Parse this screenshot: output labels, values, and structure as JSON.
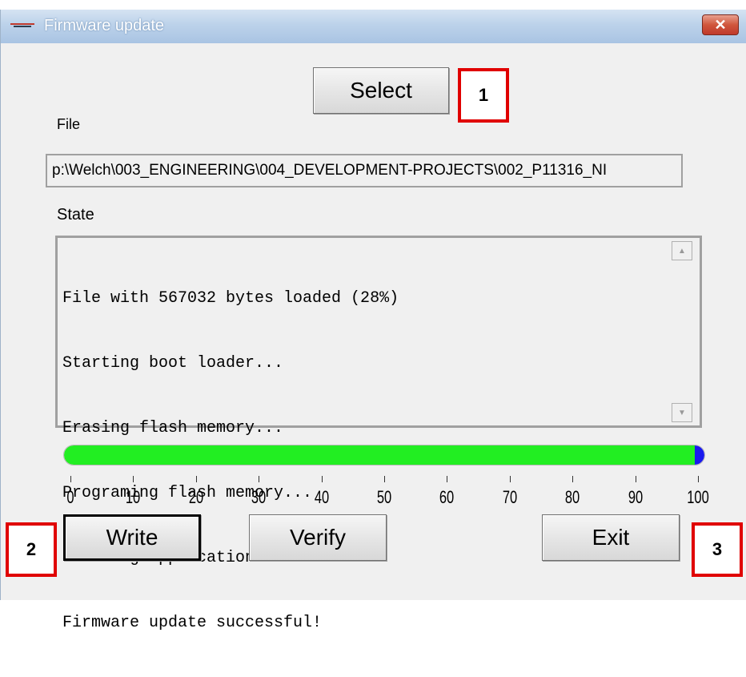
{
  "window": {
    "title": "Firmware update",
    "close_label": "✕"
  },
  "select_button": "Select",
  "file": {
    "label": "File",
    "path": "p:\\Welch\\003_ENGINEERING\\004_DEVELOPMENT-PROJECTS\\002_P11316_NI"
  },
  "state": {
    "label": "State",
    "lines": [
      "File with 567032 bytes loaded (28%)",
      "Starting boot loader...",
      "Erasing flash memory...",
      "Programing flash memory...",
      "Starting application...",
      "Firmware update successful!"
    ]
  },
  "progress": {
    "value_percent": 100,
    "ticks": [
      "0",
      "10",
      "20",
      "30",
      "40",
      "50",
      "60",
      "70",
      "80",
      "90",
      "100"
    ],
    "fill_color": "#22ee22",
    "cap_color": "#1a1aee"
  },
  "buttons": {
    "write": "Write",
    "verify": "Verify",
    "exit": "Exit"
  },
  "callouts": {
    "one": "1",
    "two": "2",
    "three": "3"
  },
  "colors": {
    "callout_border": "#e00000",
    "titlebar": "#bcd2ea"
  }
}
